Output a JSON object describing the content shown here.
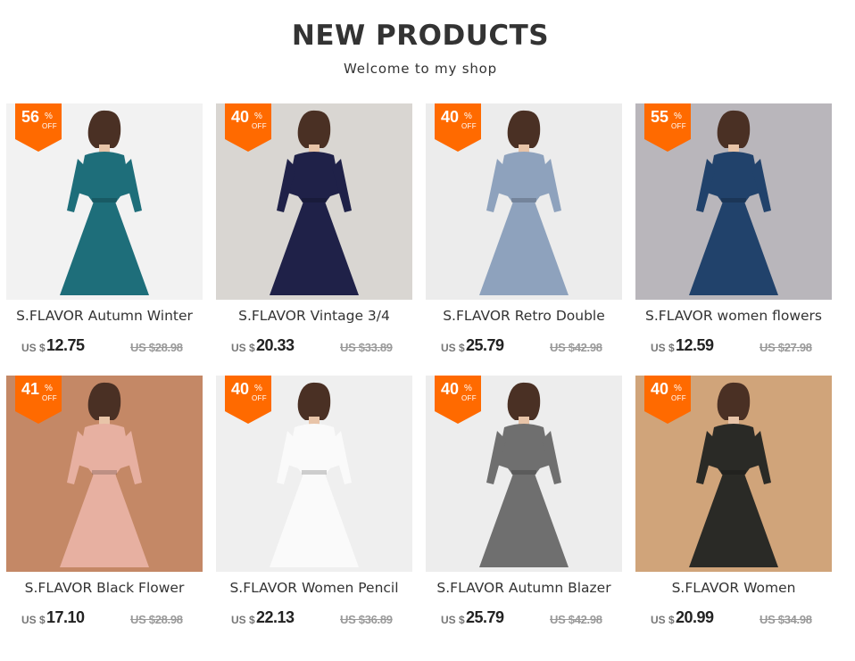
{
  "header": {
    "title": "NEW PRODUCTS",
    "subtitle": "Welcome to my shop"
  },
  "colors": {
    "badge": "#ff6a00",
    "price": "#222222",
    "old_price": "#999999"
  },
  "products": [
    {
      "name": "S.FLAVOR Autumn Winter",
      "discount": "56",
      "currency": "US $",
      "price": "12.75",
      "old_price": "US $28.98",
      "image": "teal floral dress",
      "bg": "#f2f2f2",
      "dress": "#1e6e7a"
    },
    {
      "name": "S.FLAVOR Vintage 3/4",
      "discount": "40",
      "currency": "US $",
      "price": "20.33",
      "old_price": "US $33.89",
      "image": "navy velvet dress",
      "bg": "#d9d6d2",
      "dress": "#1f2148"
    },
    {
      "name": "S.FLAVOR Retro Double",
      "discount": "40",
      "currency": "US $",
      "price": "25.79",
      "old_price": "US $42.98",
      "image": "blue plaid dress",
      "bg": "#ececec",
      "dress": "#8ea2bd"
    },
    {
      "name": "S.FLAVOR women flowers",
      "discount": "55",
      "currency": "US $",
      "price": "12.59",
      "old_price": "US $27.98",
      "image": "blue floral dress",
      "bg": "#b9b6bb",
      "dress": "#21426b"
    },
    {
      "name": "S.FLAVOR Black Flower",
      "discount": "41",
      "currency": "US $",
      "price": "17.10",
      "old_price": "US $28.98",
      "image": "pink floral pleated dress",
      "bg": "#c48866",
      "dress": "#e7b0a1"
    },
    {
      "name": "S.FLAVOR Women Pencil",
      "discount": "40",
      "currency": "US $",
      "price": "22.13",
      "old_price": "US $36.89",
      "image": "white blazer dress",
      "bg": "#efefef",
      "dress": "#fafafa"
    },
    {
      "name": "S.FLAVOR Autumn Blazer",
      "discount": "40",
      "currency": "US $",
      "price": "25.79",
      "old_price": "US $42.98",
      "image": "grey plaid dress",
      "bg": "#ededed",
      "dress": "#6f6f6f"
    },
    {
      "name": "S.FLAVOR Women",
      "discount": "40",
      "currency": "US $",
      "price": "20.99",
      "old_price": "US $34.98",
      "image": "dark floral shirt dress",
      "bg": "#d0a47a",
      "dress": "#2a2a26"
    }
  ]
}
